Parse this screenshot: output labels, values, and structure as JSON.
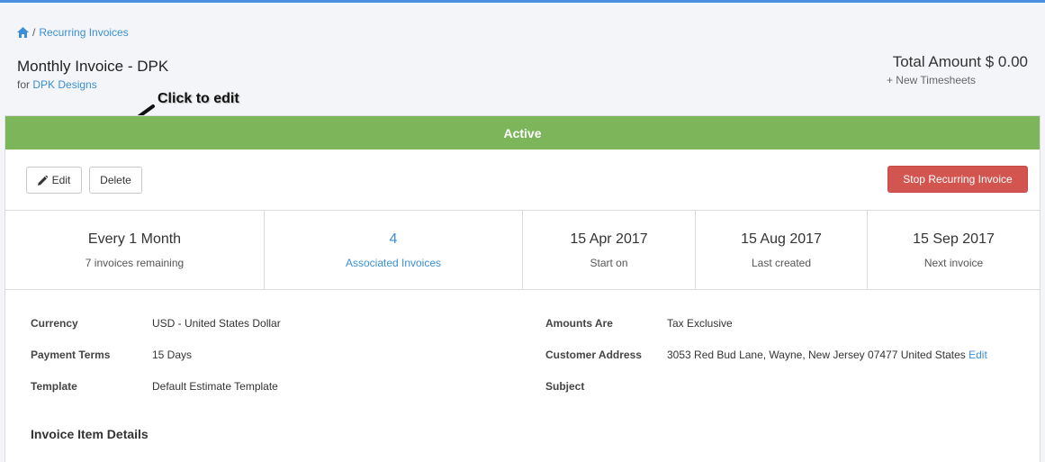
{
  "breadcrumb": {
    "home_icon": "home-icon",
    "separator": "/",
    "current": "Recurring Invoices"
  },
  "header": {
    "title": "Monthly Invoice - DPK",
    "for_prefix": "for",
    "customer": "DPK Designs",
    "total": "Total Amount $ 0.00",
    "new_timesheets": "+ New Timesheets"
  },
  "annotation": {
    "text": "Click to edit"
  },
  "status": {
    "label": "Active",
    "color": "#7db55b"
  },
  "actions": {
    "edit": "Edit",
    "delete": "Delete",
    "stop": "Stop Recurring Invoice"
  },
  "stats": [
    {
      "value": "Every 1 Month",
      "label": "7 invoices remaining"
    },
    {
      "value": "4",
      "label": "Associated Invoices"
    },
    {
      "value": "15 Apr 2017",
      "label": "Start on"
    },
    {
      "value": "15 Aug 2017",
      "label": "Last created"
    },
    {
      "value": "15 Sep 2017",
      "label": "Next invoice"
    }
  ],
  "details": {
    "left": [
      {
        "label": "Currency",
        "value": "USD - United States Dollar"
      },
      {
        "label": "Payment Terms",
        "value": "15 Days"
      },
      {
        "label": "Template",
        "value": "Default Estimate Template"
      }
    ],
    "right": [
      {
        "label": "Amounts Are",
        "value": "Tax Exclusive"
      },
      {
        "label": "Customer Address",
        "value": "3053 Red Bud Lane, Wayne, New Jersey 07477 United States",
        "edit": "Edit"
      },
      {
        "label": "Subject",
        "value": ""
      }
    ]
  },
  "section": {
    "title": "Invoice Item Details"
  }
}
